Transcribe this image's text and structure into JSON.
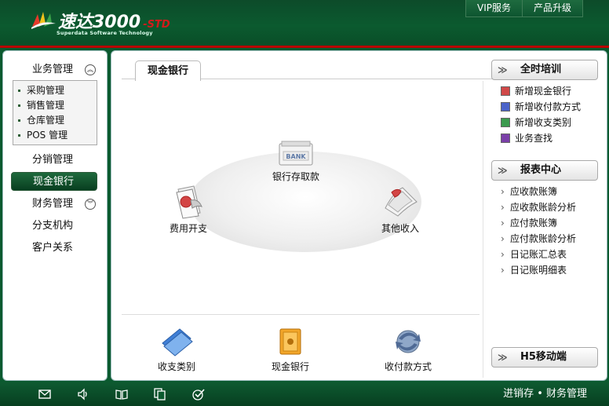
{
  "header": {
    "logo_text": "速达3000",
    "logo_edition": "-STD",
    "logo_sub": "Superdata Software Technology",
    "nav": [
      "VIP服务",
      "产品升级"
    ]
  },
  "sidebar": {
    "group1": "业务管理",
    "group1_items": [
      "采购管理",
      "销售管理",
      "仓库管理",
      "POS 管理"
    ],
    "items": [
      {
        "label": "分销管理"
      },
      {
        "label": "现金银行"
      },
      {
        "label": "财务管理"
      },
      {
        "label": "分支机构"
      },
      {
        "label": "客户关系"
      }
    ]
  },
  "main": {
    "tab": "现金银行",
    "nodes": {
      "bank": "银行存取款",
      "bank_icon_text": "BANK",
      "expense": "费用开支",
      "income": "其他收入"
    },
    "bottom": [
      "收支类别",
      "现金银行",
      "收付款方式"
    ]
  },
  "right": {
    "training": {
      "title": "全时培训",
      "items": [
        "新增现金银行",
        "新增收付款方式",
        "新增收支类别",
        "业务查找"
      ]
    },
    "reports": {
      "title": "报表中心",
      "items": [
        "应收款账簿",
        "应收款账龄分析",
        "应付款账簿",
        "应付款账龄分析",
        "日记账汇总表",
        "日记账明细表"
      ]
    },
    "mobile": {
      "title": "H5移动端"
    }
  },
  "footer": {
    "text": "进销存 • 财务管理"
  },
  "colors": {
    "brand_green": "#0b5a2f",
    "accent_red": "#b80000"
  }
}
